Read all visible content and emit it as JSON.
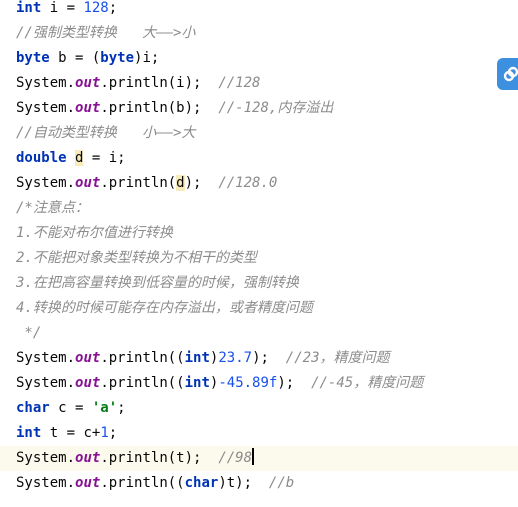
{
  "code_lines": [
    [
      {
        "t": "int",
        "c": "kw"
      },
      {
        "t": " i = "
      },
      {
        "t": "128",
        "c": "num"
      },
      {
        "t": ";"
      }
    ],
    [
      {
        "t": "//强制类型转换   大——>小",
        "c": "cmt"
      }
    ],
    [
      {
        "t": "byte",
        "c": "kw"
      },
      {
        "t": " b = ("
      },
      {
        "t": "byte",
        "c": "kw"
      },
      {
        "t": ")i;"
      }
    ],
    [
      {
        "t": "System."
      },
      {
        "t": "out",
        "c": "fld"
      },
      {
        "t": ".println(i);  "
      },
      {
        "t": "//128",
        "c": "cmt"
      }
    ],
    [
      {
        "t": "System."
      },
      {
        "t": "out",
        "c": "fld"
      },
      {
        "t": ".println(b);  "
      },
      {
        "t": "//-128,内存溢出",
        "c": "cmt"
      }
    ],
    [
      {
        "t": "//自动类型转换   小——>大",
        "c": "cmt"
      }
    ],
    [
      {
        "t": "double",
        "c": "kw"
      },
      {
        "t": " "
      },
      {
        "t": "d",
        "c": "hl-var"
      },
      {
        "t": " = i;"
      }
    ],
    [
      {
        "t": "System."
      },
      {
        "t": "out",
        "c": "fld"
      },
      {
        "t": ".println("
      },
      {
        "t": "d",
        "c": "hl-var"
      },
      {
        "t": ");  "
      },
      {
        "t": "//128.0",
        "c": "cmt"
      }
    ],
    [
      {
        "t": "/*注意点：",
        "c": "cmt"
      }
    ],
    [
      {
        "t": "1.不能对布尔值进行转换",
        "c": "cmt"
      }
    ],
    [
      {
        "t": "2.不能把对象类型转换为不相干的类型",
        "c": "cmt"
      }
    ],
    [
      {
        "t": "3.在把高容量转换到低容量的时候，强制转换",
        "c": "cmt"
      }
    ],
    [
      {
        "t": "4.转换的时候可能存在内存溢出，或者精度问题",
        "c": "cmt"
      }
    ],
    [
      {
        "t": " */",
        "c": "cmt"
      }
    ],
    [
      {
        "t": "System."
      },
      {
        "t": "out",
        "c": "fld"
      },
      {
        "t": ".println(("
      },
      {
        "t": "int",
        "c": "kw"
      },
      {
        "t": ")"
      },
      {
        "t": "23.7",
        "c": "num"
      },
      {
        "t": ");  "
      },
      {
        "t": "//23，精度问题",
        "c": "cmt"
      }
    ],
    [
      {
        "t": "System."
      },
      {
        "t": "out",
        "c": "fld"
      },
      {
        "t": ".println(("
      },
      {
        "t": "int",
        "c": "kw"
      },
      {
        "t": ")"
      },
      {
        "t": "-45.89f",
        "c": "num"
      },
      {
        "t": ");  "
      },
      {
        "t": "//-45，精度问题",
        "c": "cmt"
      }
    ],
    [
      {
        "t": "char",
        "c": "kw"
      },
      {
        "t": " c = "
      },
      {
        "t": "'a'",
        "c": "str"
      },
      {
        "t": ";"
      }
    ],
    [
      {
        "t": "int",
        "c": "kw"
      },
      {
        "t": " t = c+"
      },
      {
        "t": "1",
        "c": "num"
      },
      {
        "t": ";"
      }
    ],
    [
      {
        "t": "System."
      },
      {
        "t": "out",
        "c": "fld"
      },
      {
        "t": ".println(t);  "
      },
      {
        "t": "//98",
        "c": "cmt"
      },
      {
        "caret": true
      }
    ],
    [
      {
        "t": "System."
      },
      {
        "t": "out",
        "c": "fld"
      },
      {
        "t": ".println(("
      },
      {
        "t": "char",
        "c": "kw"
      },
      {
        "t": ")t);  "
      },
      {
        "t": "//b",
        "c": "cmt"
      }
    ]
  ],
  "current_line": 18,
  "side_icon": "link-icon",
  "colors": {
    "keyword": "#0033b3",
    "field": "#871094",
    "number": "#1750eb",
    "string": "#067d17",
    "comment": "#8c8c8c",
    "current_line_bg": "#fcfaed",
    "variable_highlight": "#f6ebbc",
    "side_icon_bg": "#3d8fe0"
  }
}
